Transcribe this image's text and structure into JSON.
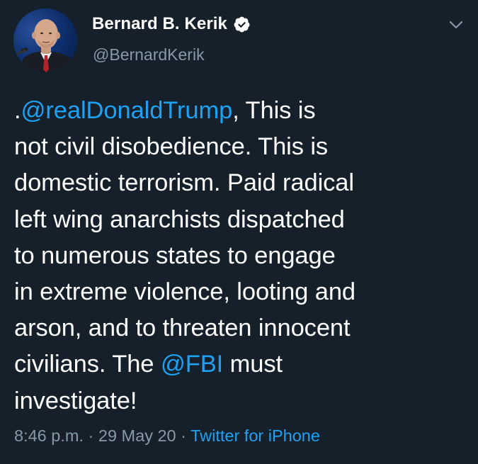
{
  "author": {
    "display_name": "Bernard B. Kerik",
    "handle": "@BernardKerik",
    "verified": true,
    "avatar_icon": "profile-photo"
  },
  "menu": {
    "icon": "chevron-down-icon"
  },
  "tweet": {
    "lines": [
      {
        "prefix": ".",
        "mention": "@realDonaldTrump",
        "suffix": ", This is"
      },
      {
        "text": "not civil disobedience. This is"
      },
      {
        "text": "domestic terrorism. Paid radical"
      },
      {
        "text": "left wing anarchists dispatched"
      },
      {
        "text": "to numerous states to engage"
      },
      {
        "text": "in extreme violence, looting and"
      },
      {
        "text": "arson, and to threaten innocent"
      },
      {
        "prefix": "civilians. The ",
        "mention": "@FBI",
        "suffix": " must"
      },
      {
        "text": "investigate!"
      }
    ]
  },
  "meta": {
    "time": "8:46 p.m.",
    "separator": " · ",
    "date": "29 May 20",
    "source": "Twitter for iPhone"
  },
  "colors": {
    "background": "#15202b",
    "accent": "#1da1f2",
    "secondary_text": "#8899a6",
    "primary_text": "#ffffff"
  }
}
